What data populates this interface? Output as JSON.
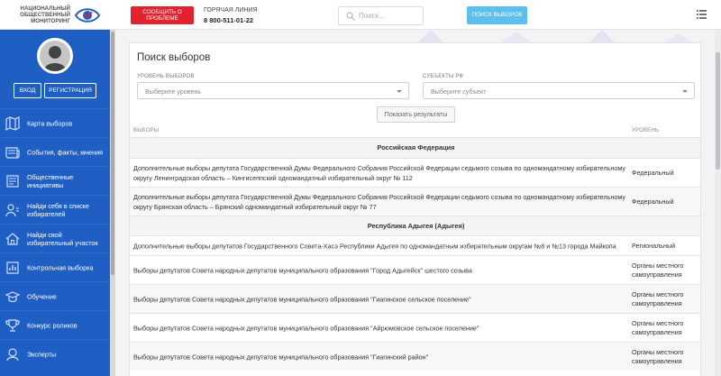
{
  "header": {
    "logo_text": "НАЦИОНАЛЬНЫЙ ОБЩЕСТВЕННЫЙ МОНИТОРИНГ",
    "report_button": "СООБЩИТЬ О ПРОБЛЕМЕ",
    "hotline_label": "ГОРЯЧАЯ ЛИНИЯ",
    "hotline_number": "8 800-511-01-22",
    "search_placeholder": "Поиск...",
    "search_button": "ПОИСК ВЫБОРОВ"
  },
  "sidebar": {
    "login": "ВХОД",
    "register": "РЕГИСТРАЦИЯ",
    "items": [
      {
        "label": "Карта выборов",
        "icon": "map-icon"
      },
      {
        "label": "События, факты, мнения",
        "icon": "news-icon"
      },
      {
        "label": "Общественные инициативы",
        "icon": "initiatives-icon"
      },
      {
        "label": "Найди себя в списке избирателей",
        "icon": "user-list-icon"
      },
      {
        "label": "Найди свой избирательный участок",
        "icon": "home-icon"
      },
      {
        "label": "Контрольная выборка",
        "icon": "report-icon"
      },
      {
        "label": "Обучение",
        "icon": "graduation-icon"
      },
      {
        "label": "Конкурс роликов",
        "icon": "trophy-icon"
      },
      {
        "label": "Эксперты",
        "icon": "experts-icon"
      }
    ]
  },
  "main": {
    "title": "Поиск выборов",
    "level_label": "УРОВЕНЬ ВЫБОРОВ",
    "level_placeholder": "Выберите уровень",
    "subject_label": "СУБЪЕКТЫ РФ",
    "subject_placeholder": "Выберите субъект",
    "show_button": "Показать результаты",
    "col_elections": "ВЫБОРЫ",
    "col_level": "УРОВЕНЬ"
  },
  "table": {
    "group1": "Российская Федерация",
    "group2": "Республика Адыгея (Адыгея)",
    "rows": [
      {
        "name": "Дополнительные выборы депутата Государственной Думы Федерального Собрания Российской Федерации седьмого созыва по одномандатному избирательному округу Ленинградская область – Кингисеппский одномандатный избирательный округ № 112",
        "level": "Федеральный"
      },
      {
        "name": "Дополнительные выборы депутата Государственной Думы Федерального Собрания Российской Федерации седьмого созыва по одномандатному избирательному округу Брянская область – Брянский одномандатный избирательный округ № 77",
        "level": "Федеральный"
      },
      {
        "name": "Дополнительные выборы депутатов Государственного Совета-Хасэ Республики Адыгея по одномандатным избирательным округам №8 и №13 города Майкопа",
        "level": "Региональный"
      },
      {
        "name": "Выборы депутатов Совета народных депутатов муниципального образования \"Город Адыгейск\" шестого созыва",
        "level": "Органы местного самоуправления"
      },
      {
        "name": "Выборы депутатов Совета народных депутатов муниципального образования \"Гиагинское сельское поселение\"",
        "level": "Органы местного самоуправления"
      },
      {
        "name": "Выборы депутатов Совета народных депутатов муниципального образования \"Айрюмовское сельское поселение\"",
        "level": "Органы местного самоуправления"
      },
      {
        "name": "Выборы депутатов Совета народных депутатов муниципального образования \"Гиагинский район\"",
        "level": "Органы местного самоуправления"
      }
    ]
  },
  "colors": {
    "sidebar": "#1f5fc3",
    "report": "#e0232e",
    "search_button": "#5bc0f0"
  }
}
